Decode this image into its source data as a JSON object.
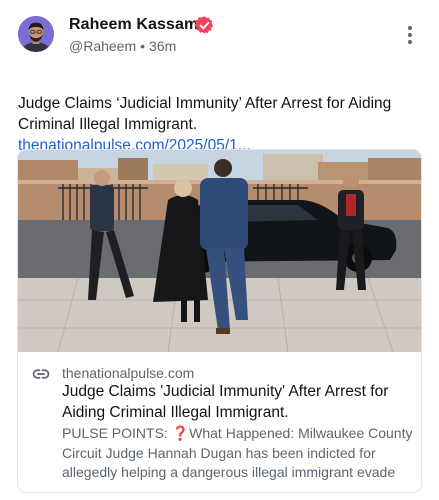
{
  "author": {
    "name": "Raheem Kassam",
    "handle": "@Raheem",
    "time": "36m",
    "verified": true
  },
  "post": {
    "text": "Judge Claims ‘Judicial Immunity’ After Arrest for Aiding Criminal Illegal Immigrant.",
    "link": "thenationalpulse.com/2025/05/1..."
  },
  "card": {
    "domain": "thenationalpulse.com",
    "title": "Judge Claims 'Judicial Immunity' After Arrest for Aiding Criminal Illegal Immigrant.",
    "desc_prefix": "PULSE POINTS: ",
    "desc_icon": "❓",
    "desc_rest": "What Happened: Milwaukee County Circuit Judge Hannah Dugan has been indicted for allegedly helping a dangerous illegal immigrant evade"
  },
  "icons": {
    "verified": "verified-badge-icon",
    "more": "more-vertical-icon",
    "link": "link-chain-icon"
  },
  "colors": {
    "accent_link": "#1e5fd0",
    "verified_badge": "#f1435e",
    "secondary_text": "#5b6670",
    "avatar_bg": "#7d6bd6"
  }
}
